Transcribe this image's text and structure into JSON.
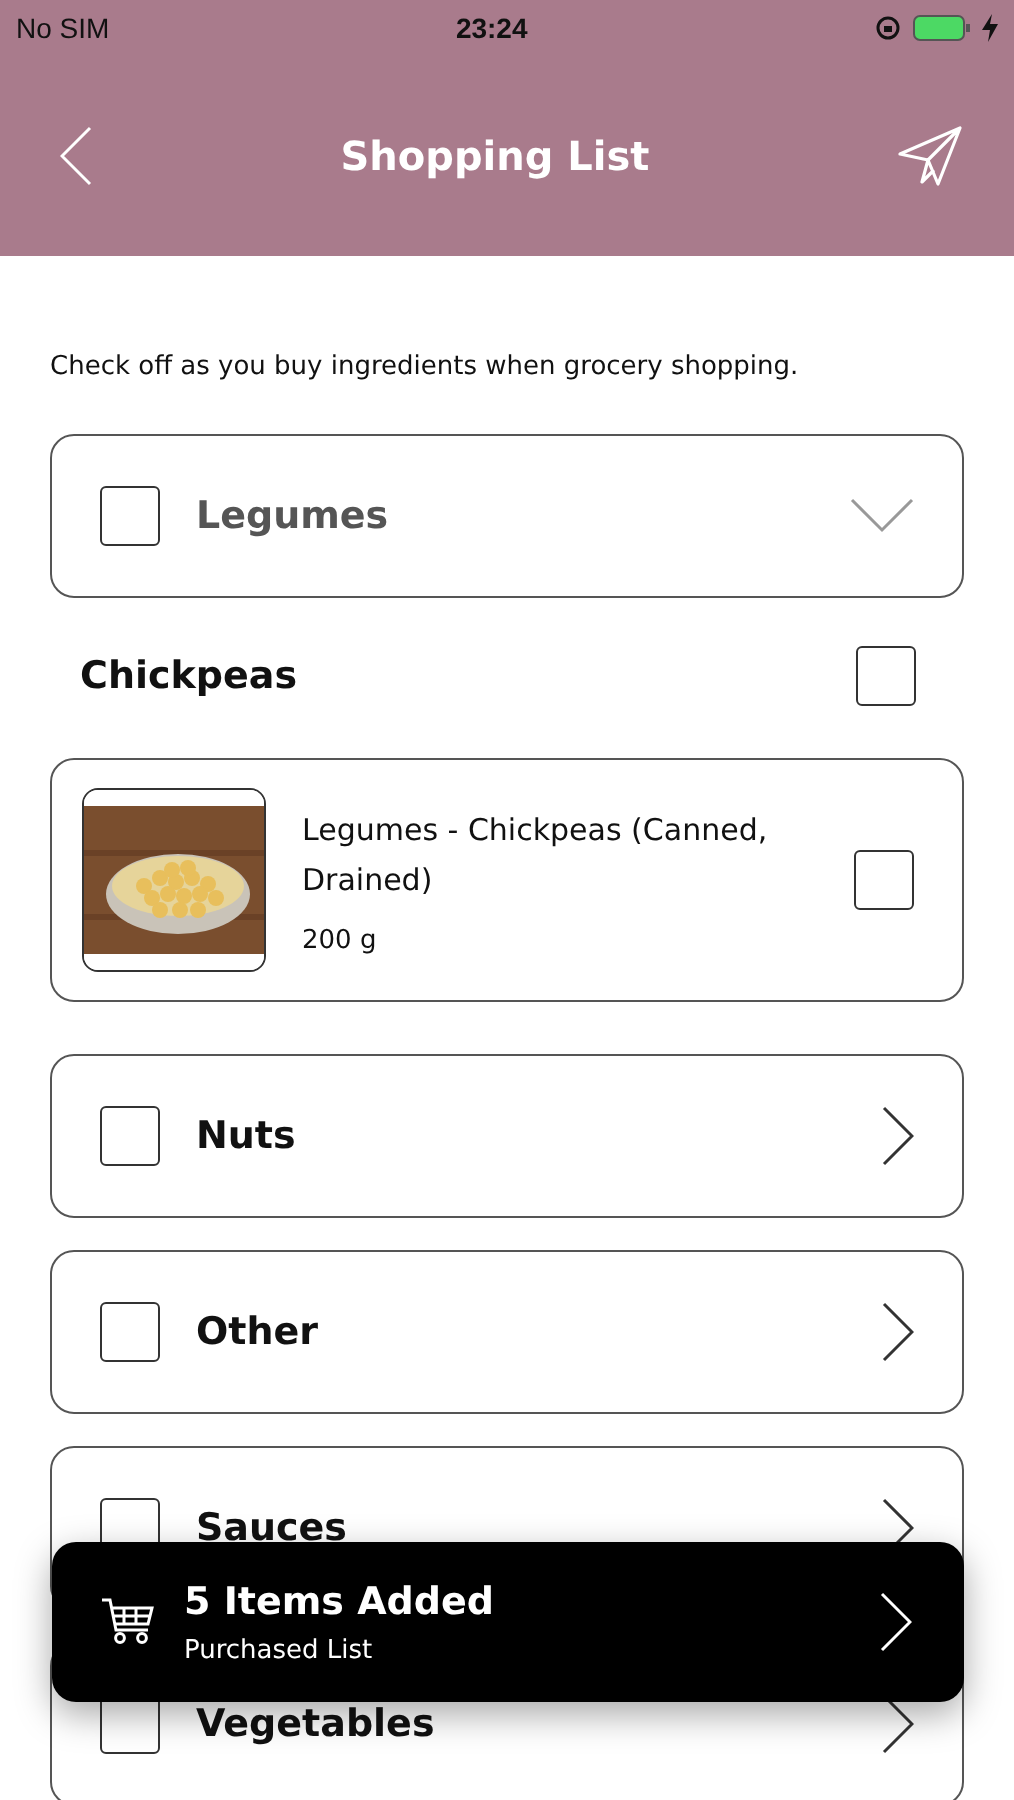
{
  "status_bar": {
    "carrier": "No SIM",
    "time": "23:24",
    "battery_charging": true
  },
  "header": {
    "title": "Shopping List"
  },
  "description": "Check off as you buy ingredients when grocery shopping.",
  "categories": [
    {
      "name": "Legumes",
      "checked": false,
      "expanded": true,
      "groups": [
        {
          "name": "Chickpeas",
          "checked": false,
          "items": [
            {
              "kind": "picture",
              "title": "Legumes - Chickpeas (Canned, Drained)",
              "amount": "200 g",
              "checked": false
            }
          ]
        }
      ]
    },
    {
      "name": "Nuts",
      "checked": false,
      "expanded": false
    },
    {
      "name": "Other",
      "checked": false,
      "expanded": false
    },
    {
      "name": "Sauces",
      "checked": false,
      "expanded": false
    },
    {
      "name": "Vegetables",
      "checked": false,
      "expanded": false
    }
  ],
  "toast": {
    "title": "5 Items Added",
    "subtitle": "Purchased List"
  }
}
